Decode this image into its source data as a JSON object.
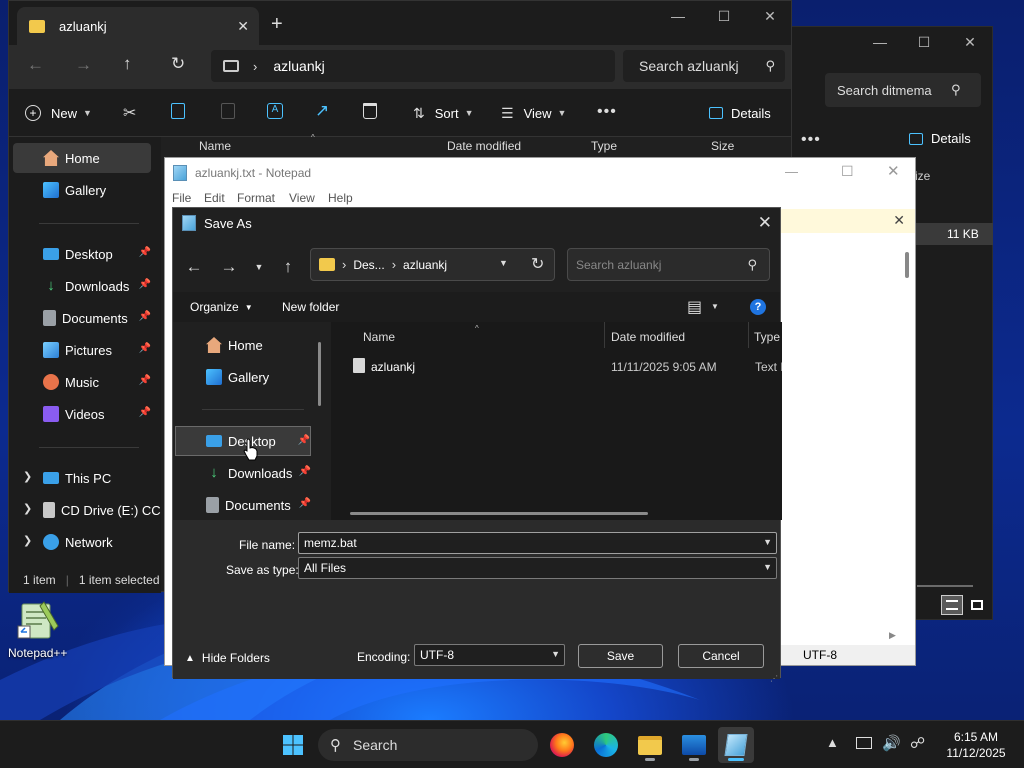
{
  "colors": {
    "accent": "#4cc2ff",
    "folder": "#f2c94c",
    "desktop_selected": "#3a3a3a"
  },
  "explorer_bg": {
    "search_placeholder": "Search ditmema",
    "details_label": "Details",
    "col_size_partial": "ize",
    "file_size": "11 KB"
  },
  "explorer": {
    "tab_title": "azluankj",
    "address": "azluankj",
    "search_placeholder": "Search azluankj",
    "toolbar": {
      "new_label": "New",
      "sort_label": "Sort",
      "view_label": "View",
      "details_label": "Details"
    },
    "columns": {
      "name": "Name",
      "date": "Date modified",
      "type": "Type",
      "size": "Size"
    },
    "nav": [
      {
        "label": "Home",
        "icon": "home-icon"
      },
      {
        "label": "Gallery",
        "icon": "gallery-icon"
      },
      {
        "label": "Desktop",
        "icon": "desktop-icon"
      },
      {
        "label": "Downloads",
        "icon": "download-icon"
      },
      {
        "label": "Documents",
        "icon": "documents-icon"
      },
      {
        "label": "Pictures",
        "icon": "pictures-icon"
      },
      {
        "label": "Music",
        "icon": "music-icon"
      },
      {
        "label": "Videos",
        "icon": "videos-icon"
      },
      {
        "label": "This PC",
        "icon": "computer-icon"
      },
      {
        "label": "CD Drive (E:) CC",
        "icon": "cd-drive-icon"
      },
      {
        "label": "Network",
        "icon": "network-icon"
      }
    ],
    "status": {
      "count": "1 item",
      "selected": "1 item selected"
    }
  },
  "notepad": {
    "title": "azluankj.txt - Notepad",
    "menu": [
      "File",
      "Edit",
      "Format",
      "View",
      "Help"
    ],
    "encoding_status": "UTF-8"
  },
  "saveas": {
    "title": "Save As",
    "path_segments": [
      "Des...",
      "azluankj"
    ],
    "search_placeholder": "Search azluankj",
    "organize_label": "Organize",
    "new_folder_label": "New folder",
    "nav": [
      {
        "label": "Home",
        "icon": "home-icon"
      },
      {
        "label": "Gallery",
        "icon": "gallery-icon"
      },
      {
        "label": "Desktop",
        "icon": "desktop-icon"
      },
      {
        "label": "Downloads",
        "icon": "download-icon"
      },
      {
        "label": "Documents",
        "icon": "documents-icon"
      }
    ],
    "columns": {
      "name": "Name",
      "date": "Date modified",
      "type": "Type"
    },
    "files": [
      {
        "name": "azluankj",
        "date": "11/11/2025 9:05 AM",
        "type": "Text D"
      }
    ],
    "file_name_label": "File name:",
    "file_name_value": "memz.bat",
    "save_type_label": "Save as type:",
    "save_type_value": "All Files",
    "hide_folders_label": "Hide Folders",
    "encoding_label": "Encoding:",
    "encoding_value": "UTF-8",
    "save_button": "Save",
    "cancel_button": "Cancel"
  },
  "desktop": {
    "notepadpp_label": "Notepad++"
  },
  "taskbar": {
    "search_label": "Search",
    "time": "6:15 AM",
    "date": "11/12/2025"
  }
}
